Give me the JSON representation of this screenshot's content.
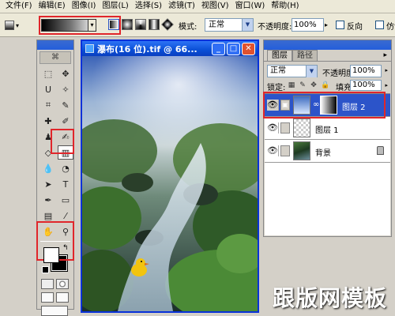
{
  "menubar": {
    "items": [
      "文件(F)",
      "编辑(E)",
      "图像(I)",
      "图层(L)",
      "选择(S)",
      "滤镜(T)",
      "视图(V)",
      "窗口(W)",
      "帮助(H)"
    ]
  },
  "options": {
    "mode_label": "模式:",
    "mode_value": "正常",
    "opacity_label": "不透明度:",
    "opacity_value": "100%",
    "reverse_label": "反向",
    "dither_label": "仿色"
  },
  "document": {
    "title": "瀑布(16 位).tif @ 66..."
  },
  "layers_panel": {
    "tabs": [
      "图层",
      "路径"
    ],
    "blend_mode": "正常",
    "opacity_label": "不透明度:",
    "opacity_value": "100%",
    "lock_label": "锁定:",
    "fill_label": "填充:",
    "fill_value": "100%",
    "layers": [
      {
        "name": "图层 2",
        "active": true
      },
      {
        "name": "图层 1",
        "active": false
      },
      {
        "name": "背景",
        "active": false
      }
    ]
  },
  "watermark": "跟版网模板",
  "accent_colors": {
    "highlight_red": "#e0262b",
    "xp_blue": "#0831d9",
    "layer_selected": "#2c54c9"
  }
}
